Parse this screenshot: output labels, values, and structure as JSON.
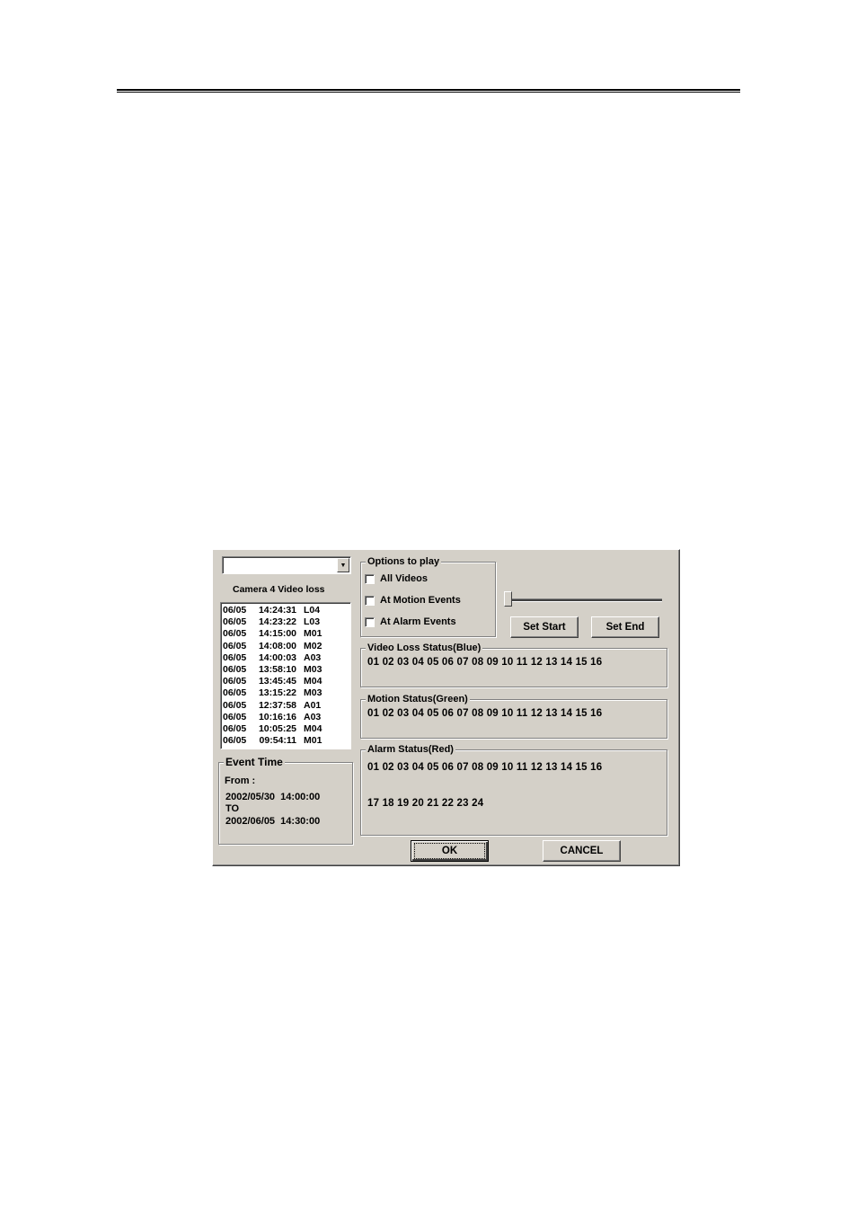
{
  "dialog": {
    "camera_select": {
      "value": ""
    },
    "camera_label": "Camera 4 Video loss",
    "event_list": [
      {
        "date": "06/05",
        "time": "14:24:31",
        "code": "L04"
      },
      {
        "date": "06/05",
        "time": "14:23:22",
        "code": "L03"
      },
      {
        "date": "06/05",
        "time": "14:15:00",
        "code": "M01"
      },
      {
        "date": "06/05",
        "time": "14:08:00",
        "code": "M02"
      },
      {
        "date": "06/05",
        "time": "14:00:03",
        "code": "A03"
      },
      {
        "date": "06/05",
        "time": "13:58:10",
        "code": "M03"
      },
      {
        "date": "06/05",
        "time": "13:45:45",
        "code": "M04"
      },
      {
        "date": "06/05",
        "time": "13:15:22",
        "code": "M03"
      },
      {
        "date": "06/05",
        "time": "12:37:58",
        "code": "A01"
      },
      {
        "date": "06/05",
        "time": "10:16:16",
        "code": "A03"
      },
      {
        "date": "06/05",
        "time": "10:05:25",
        "code": "M04"
      },
      {
        "date": "06/05",
        "time": "09:54:11",
        "code": "M01"
      }
    ],
    "event_time": {
      "title": "Event Time",
      "from_label": "From :",
      "from_value": "2002/05/30  14:00:00",
      "to_label": "TO",
      "to_value": "2002/06/05  14:30:00"
    },
    "options": {
      "title": "Options to play",
      "items": [
        {
          "label": "All Videos",
          "checked": false
        },
        {
          "label": "At Motion Events",
          "checked": false
        },
        {
          "label": "At Alarm Events",
          "checked": false
        }
      ]
    },
    "slider": {
      "value_fraction": 0.0
    },
    "set_start_label": "Set Start",
    "set_end_label": "Set End",
    "video_loss": {
      "title": "Video Loss Status(Blue)",
      "row1": "01 02 03 04 05 06 07 08 09 10 11 12 13 14 15 16"
    },
    "motion": {
      "title": "Motion Status(Green)",
      "row1": "01 02 03 04 05 06 07 08 09 10 11 12 13 14 15 16"
    },
    "alarm": {
      "title": "Alarm Status(Red)",
      "row1": "01 02 03 04 05 06 07 08 09 10 11 12 13 14 15 16",
      "row2": "17 18 19 20 21 22 23 24"
    },
    "ok_label": "OK",
    "cancel_label": "CANCEL"
  }
}
